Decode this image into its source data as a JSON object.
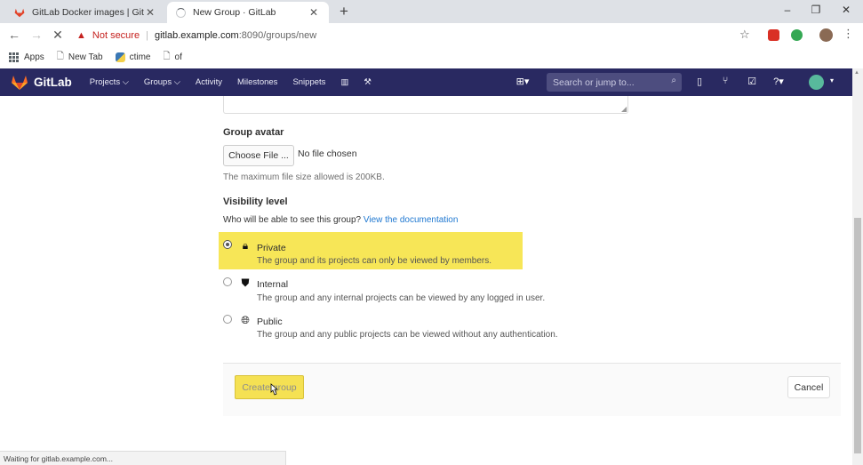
{
  "browser": {
    "tabs": [
      {
        "title": "GitLab Docker images | GitLab",
        "close": "✕"
      },
      {
        "title": "New Group · GitLab",
        "close": "✕"
      }
    ],
    "new_tab": "+",
    "window_controls": {
      "minimize": "–",
      "maximize": "❐",
      "close": "✕"
    },
    "security_warning": "Not secure",
    "url_host": "gitlab.example.com",
    "url_path": ":8090/groups/new",
    "bookmarks": [
      "Apps",
      "New Tab",
      "ctime",
      "of"
    ],
    "status_text": "Waiting for gitlab.example.com..."
  },
  "gitlab_nav": {
    "brand": "GitLab",
    "menu": [
      "Projects ⌵",
      "Groups ⌵",
      "Activity",
      "Milestones",
      "Snippets"
    ],
    "search_placeholder": "Search or jump to...",
    "accent": "#292961"
  },
  "form": {
    "avatar_label": "Group avatar",
    "choose_file": "Choose File ...",
    "no_file": "No file chosen",
    "max_size": "The maximum file size allowed is 200KB.",
    "visibility_label": "Visibility level",
    "visibility_question": "Who will be able to see this group?",
    "visibility_link": "View the documentation",
    "options": [
      {
        "title": "Private",
        "desc": "The group and its projects can only be viewed by members.",
        "selected": true,
        "icon": "lock-icon"
      },
      {
        "title": "Internal",
        "desc": "The group and any internal projects can be viewed by any logged in user.",
        "selected": false,
        "icon": "shield-icon"
      },
      {
        "title": "Public",
        "desc": "The group and any public projects can be viewed without any authentication.",
        "selected": false,
        "icon": "globe-icon"
      }
    ],
    "create_button": "Create group",
    "cancel_button": "Cancel",
    "highlight_color": "#f7e657"
  }
}
